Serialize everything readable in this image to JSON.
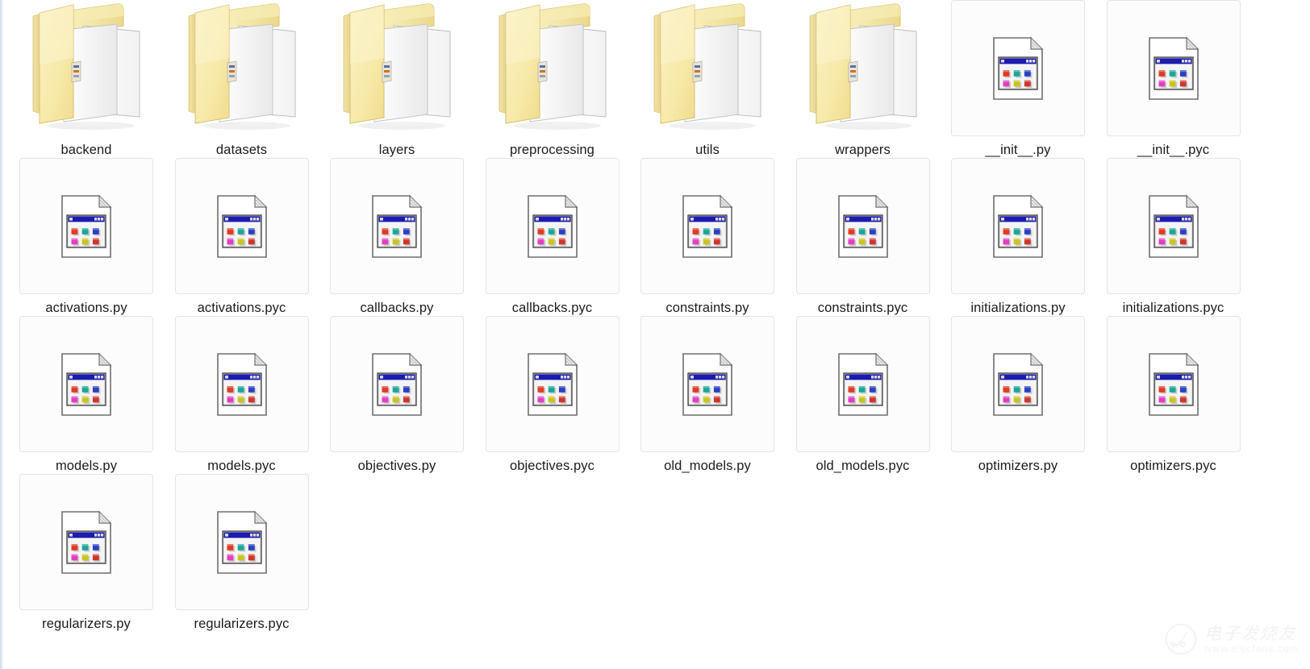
{
  "view": {
    "name": "windows-explorer-large-icons",
    "columns": 8,
    "background_color": "#ffffff",
    "cell_border_color": "#e4e4e4",
    "cell_fill_color": "#fcfcfd",
    "label_color": "#1b1b1b",
    "left_edge_color": "#cfdcec"
  },
  "items": [
    {
      "name": "backend",
      "type": "folder",
      "icon": "folder-open-icon"
    },
    {
      "name": "datasets",
      "type": "folder",
      "icon": "folder-open-icon"
    },
    {
      "name": "layers",
      "type": "folder",
      "icon": "folder-open-icon"
    },
    {
      "name": "preprocessing",
      "type": "folder",
      "icon": "folder-open-icon"
    },
    {
      "name": "utils",
      "type": "folder",
      "icon": "folder-open-icon"
    },
    {
      "name": "wrappers",
      "type": "folder",
      "icon": "folder-open-icon"
    },
    {
      "name": "__init__.py",
      "type": "file",
      "icon": "file-document-icon"
    },
    {
      "name": "__init__.pyc",
      "type": "file",
      "icon": "file-document-icon"
    },
    {
      "name": "activations.py",
      "type": "file",
      "icon": "file-document-icon"
    },
    {
      "name": "activations.pyc",
      "type": "file",
      "icon": "file-document-icon"
    },
    {
      "name": "callbacks.py",
      "type": "file",
      "icon": "file-document-icon"
    },
    {
      "name": "callbacks.pyc",
      "type": "file",
      "icon": "file-document-icon"
    },
    {
      "name": "constraints.py",
      "type": "file",
      "icon": "file-document-icon"
    },
    {
      "name": "constraints.pyc",
      "type": "file",
      "icon": "file-document-icon"
    },
    {
      "name": "initializations.py",
      "type": "file",
      "icon": "file-document-icon"
    },
    {
      "name": "initializations.pyc",
      "type": "file",
      "icon": "file-document-icon"
    },
    {
      "name": "models.py",
      "type": "file",
      "icon": "file-document-icon"
    },
    {
      "name": "models.pyc",
      "type": "file",
      "icon": "file-document-icon"
    },
    {
      "name": "objectives.py",
      "type": "file",
      "icon": "file-document-icon"
    },
    {
      "name": "objectives.pyc",
      "type": "file",
      "icon": "file-document-icon"
    },
    {
      "name": "old_models.py",
      "type": "file",
      "icon": "file-document-icon"
    },
    {
      "name": "old_models.pyc",
      "type": "file",
      "icon": "file-document-icon"
    },
    {
      "name": "optimizers.py",
      "type": "file",
      "icon": "file-document-icon"
    },
    {
      "name": "optimizers.pyc",
      "type": "file",
      "icon": "file-document-icon"
    },
    {
      "name": "regularizers.py",
      "type": "file",
      "icon": "file-document-icon"
    },
    {
      "name": "regularizers.pyc",
      "type": "file",
      "icon": "file-document-icon"
    }
  ],
  "watermark": {
    "logo": "circuit-node-circle-icon",
    "chinese_text": "电子发烧友",
    "url_text": "www.elecfans.com"
  }
}
